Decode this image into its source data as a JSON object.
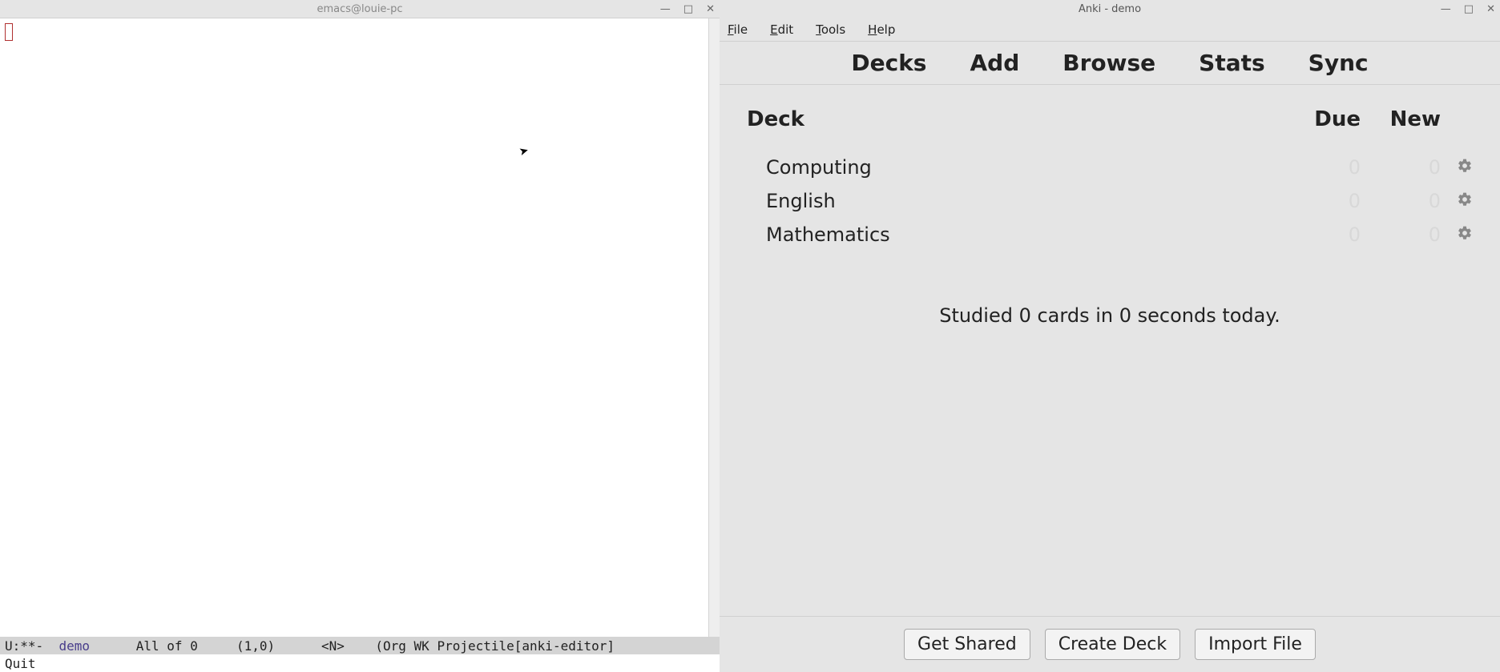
{
  "emacs": {
    "title": "emacs@louie-pc",
    "modeline": {
      "prefix": "U:**-  ",
      "buffer_name": "demo",
      "position": "      All of 0     (1,0)      <N>    (Org WK Projectile[anki-editor]"
    },
    "minibuffer": "Quit"
  },
  "anki": {
    "title": "Anki - demo",
    "menu": {
      "file": "File",
      "edit": "Edit",
      "tools": "Tools",
      "help": "Help"
    },
    "tabs": {
      "decks": "Decks",
      "add": "Add",
      "browse": "Browse",
      "stats": "Stats",
      "sync": "Sync"
    },
    "headers": {
      "deck": "Deck",
      "due": "Due",
      "new": "New"
    },
    "decks": [
      {
        "name": "Computing",
        "due": "0",
        "new": "0"
      },
      {
        "name": "English",
        "due": "0",
        "new": "0"
      },
      {
        "name": "Mathematics",
        "due": "0",
        "new": "0"
      }
    ],
    "studied": "Studied 0 cards in 0 seconds today.",
    "buttons": {
      "get_shared": "Get Shared",
      "create_deck": "Create Deck",
      "import_file": "Import File"
    }
  }
}
